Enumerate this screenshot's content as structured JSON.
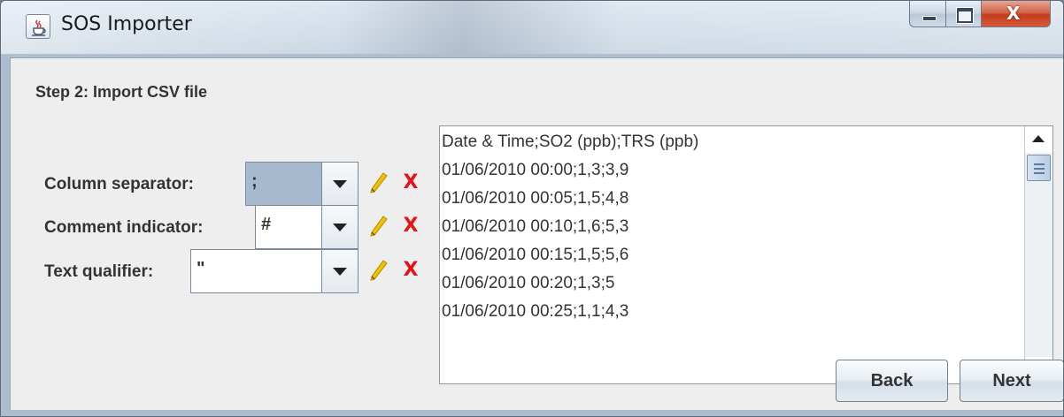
{
  "window": {
    "title": "SOS Importer",
    "close_label": "X"
  },
  "step": {
    "title": "Step 2: Import CSV file"
  },
  "options": [
    {
      "label": "Column separator:",
      "value": ";"
    },
    {
      "label": "Comment indicator:",
      "value": "#"
    },
    {
      "label": "Text qualifier:",
      "value": "\""
    }
  ],
  "delete_glyph": "X",
  "preview": {
    "lines": [
      "Date & Time;SO2 (ppb);TRS (ppb)",
      "01/06/2010 00:00;1,3;3,9",
      "01/06/2010 00:05;1,5;4,8",
      "01/06/2010 00:10;1,6;5,3",
      "01/06/2010 00:15;1,5;5,6",
      "01/06/2010 00:20;1,3;5",
      "01/06/2010 00:25;1,1;4,3"
    ]
  },
  "buttons": {
    "back": "Back",
    "next": "Next"
  },
  "colors": {
    "delete": "#e8101a",
    "edit": "#f2c200",
    "selection": "#a6b9cf"
  },
  "icons": {
    "app": "java-cup-icon",
    "edit": "pencil-icon",
    "delete": "x-icon"
  }
}
